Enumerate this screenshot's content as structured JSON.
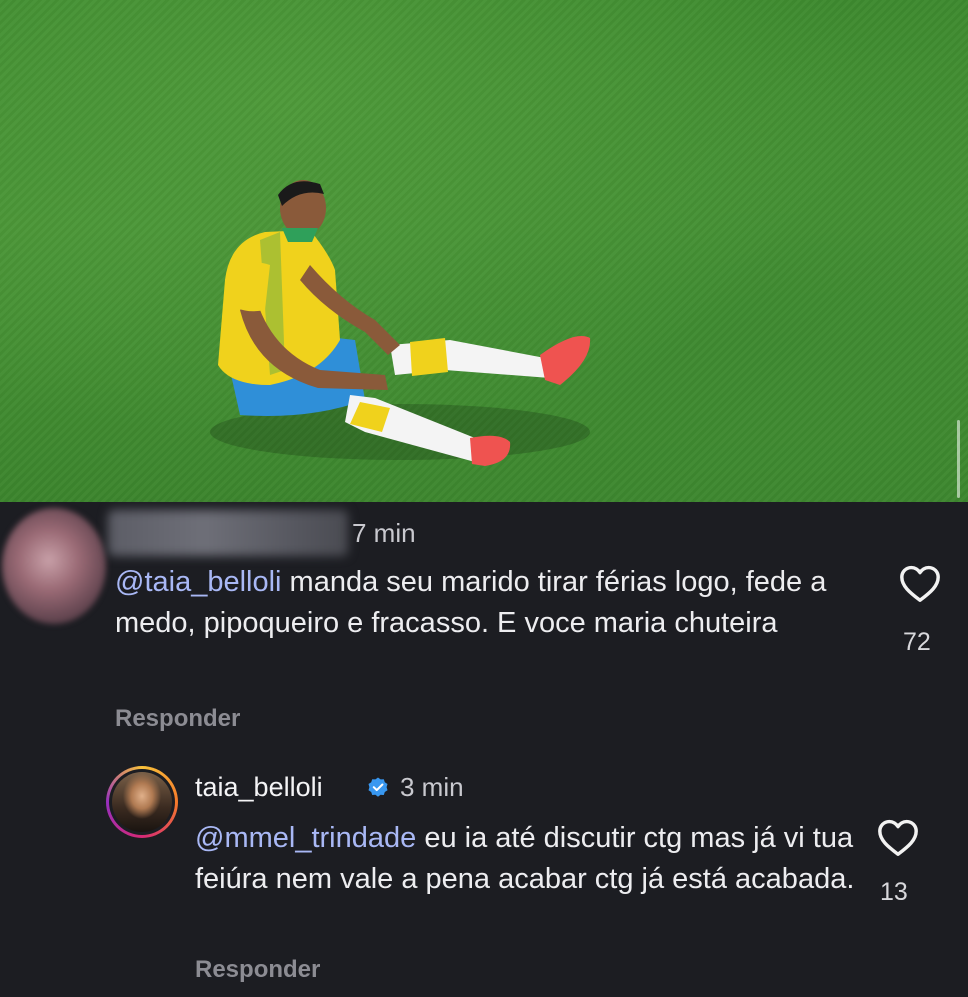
{
  "post": {
    "image_alt": "Soccer player in yellow jersey and blue shorts sitting on a green grass field"
  },
  "comments": [
    {
      "username_blurred": true,
      "time": "7 min",
      "mention": "@taia_belloli",
      "text": " manda seu marido tirar férias logo, fede a medo, pipoqueiro e fracasso. E voce maria chuteira",
      "likes": "72",
      "reply_label": "Responder"
    },
    {
      "username": "taia_belloli",
      "verified": true,
      "time": "3 min",
      "mention": "@mmel_trindade",
      "text": " eu ia até discutir ctg mas já vi tua feiúra nem vale a pena acabar ctg já está acabada.",
      "likes": "13",
      "reply_label": "Responder"
    }
  ],
  "colors": {
    "background": "#1c1d22",
    "mention": "#a9b8f5",
    "verified": "#3897f0",
    "grass": "#4a9537"
  },
  "icons": [
    "heart-icon",
    "verified-badge-icon"
  ]
}
